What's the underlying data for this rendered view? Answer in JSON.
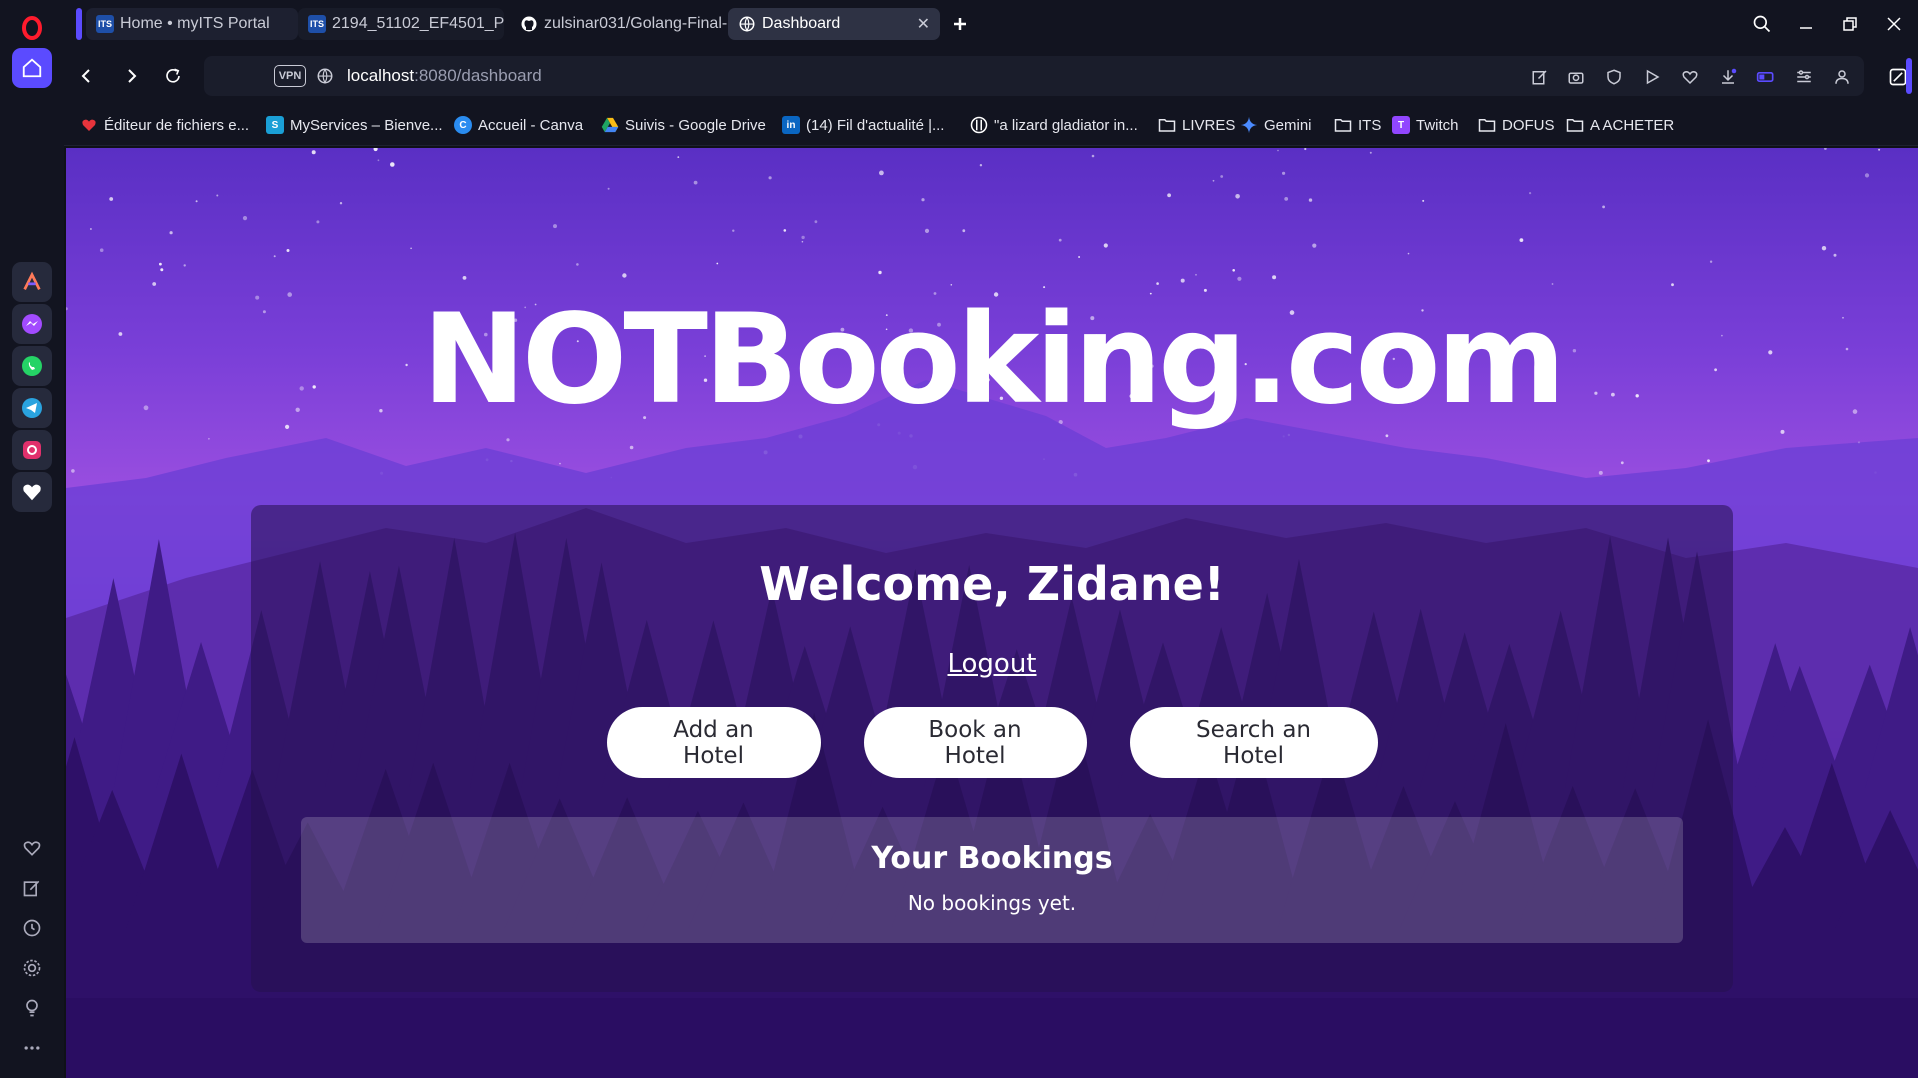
{
  "browser": {
    "tabs": [
      {
        "label": "Home • myITS Portal",
        "icon": "its-icon"
      },
      {
        "label": "2194_51102_EF4501_Pemr",
        "icon": "its-icon"
      },
      {
        "label": "zulsinar031/Golang-Final-",
        "icon": "github-icon"
      },
      {
        "label": "Dashboard",
        "icon": "globe-icon",
        "active": true
      }
    ],
    "url_host": "localhost",
    "url_rest": ":8080/dashboard",
    "vpn_label": "VPN",
    "bookmarks": [
      {
        "label": "Éditeur de fichiers e..."
      },
      {
        "label": "MyServices – Bienve..."
      },
      {
        "label": "Accueil - Canva"
      },
      {
        "label": "Suivis - Google Drive"
      },
      {
        "label": "(14) Fil d'actualité |..."
      },
      {
        "label": "\"a lizard gladiator in..."
      },
      {
        "label": "LIVRES"
      },
      {
        "label": "Gemini"
      },
      {
        "label": "ITS"
      },
      {
        "label": "Twitch"
      },
      {
        "label": "DOFUS"
      },
      {
        "label": "A ACHETER"
      }
    ]
  },
  "page": {
    "brand": "NOTBooking.com",
    "welcome": "Welcome, Zidane!",
    "logout_label": "Logout",
    "buttons": {
      "add": "Add an Hotel",
      "book": "Book an Hotel",
      "search": "Search an Hotel"
    },
    "bookings": {
      "title": "Your Bookings",
      "empty_text": "No bookings yet."
    }
  },
  "colors": {
    "accent": "#5b4bff",
    "opera_red": "#ff1b2d"
  }
}
